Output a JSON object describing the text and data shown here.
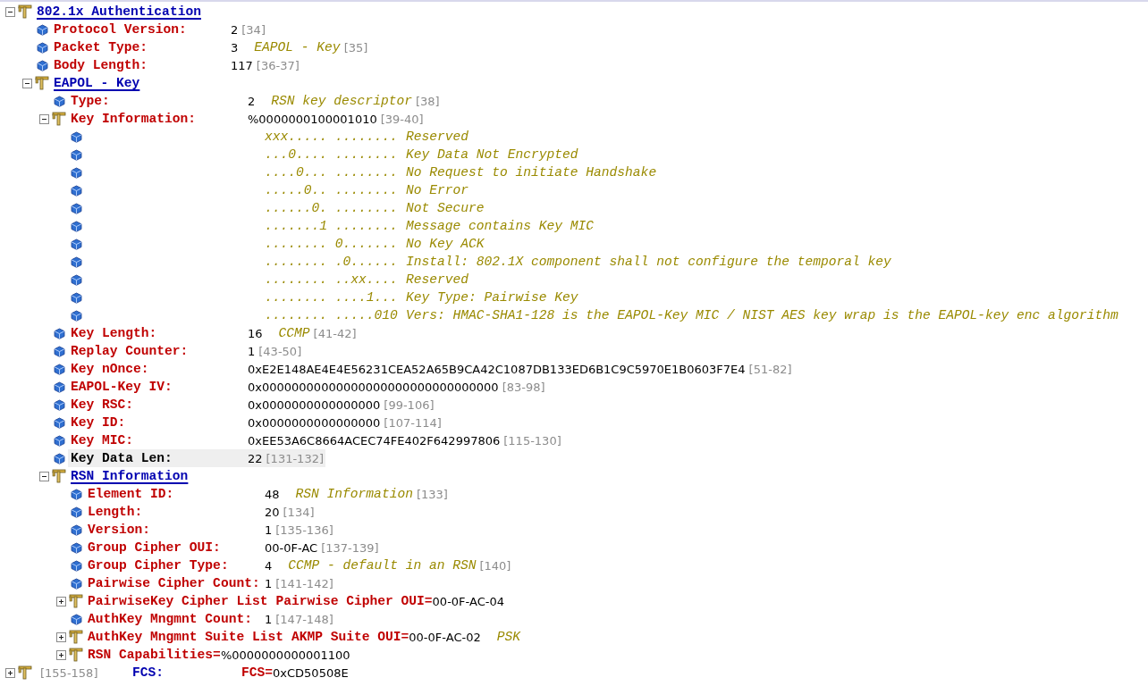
{
  "tree": [
    {
      "kind": "group",
      "label": "802.1x Authentication",
      "expanded": true,
      "selected": false,
      "children": [
        {
          "kind": "field",
          "label": "Protocol Version:",
          "value": "2",
          "range": "[34]",
          "selected": false
        },
        {
          "kind": "field",
          "label": "Packet Type:",
          "value": "3",
          "description": "EAPOL - Key",
          "range": "[35]",
          "selected": false
        },
        {
          "kind": "field",
          "label": "Body Length:",
          "value": "117",
          "range": "[36-37]",
          "selected": false
        },
        {
          "kind": "group",
          "label": "EAPOL - Key",
          "expanded": true,
          "selected": false,
          "children": [
            {
              "kind": "field",
              "label": "Type:",
              "value": "2",
              "description": "RSN key descriptor",
              "range": "[38]",
              "selected": false
            },
            {
              "kind": "group",
              "label": "Key Information:",
              "value": "%0000000100001010",
              "range": "[39-40]",
              "expanded": true,
              "selected": false,
              "children": [
                {
                  "kind": "bits",
                  "bits": "xxx..... ........",
                  "description": "Reserved",
                  "selected": false
                },
                {
                  "kind": "bits",
                  "bits": "...0.... ........",
                  "description": "Key Data Not Encrypted",
                  "selected": false
                },
                {
                  "kind": "bits",
                  "bits": "....0... ........",
                  "description": "No Request to initiate Handshake",
                  "selected": false
                },
                {
                  "kind": "bits",
                  "bits": ".....0.. ........",
                  "description": "No Error",
                  "selected": false
                },
                {
                  "kind": "bits",
                  "bits": "......0. ........",
                  "description": "Not Secure",
                  "selected": false
                },
                {
                  "kind": "bits",
                  "bits": ".......1 ........",
                  "description": "Message contains Key MIC",
                  "selected": false
                },
                {
                  "kind": "bits",
                  "bits": "........ 0.......",
                  "description": "No Key ACK",
                  "selected": false
                },
                {
                  "kind": "bits",
                  "bits": "........ .0......",
                  "description": "Install: 802.1X component shall not configure the temporal key",
                  "selected": false
                },
                {
                  "kind": "bits",
                  "bits": "........ ..xx....",
                  "description": "Reserved",
                  "selected": false
                },
                {
                  "kind": "bits",
                  "bits": "........ ....1...",
                  "description": "Key Type: Pairwise Key",
                  "selected": false
                },
                {
                  "kind": "bits",
                  "bits": "........ .....010",
                  "description": "Vers: HMAC-SHA1-128 is the EAPOL-Key MIC / NIST AES key wrap is the EAPOL-key enc algorithm",
                  "selected": false
                }
              ]
            },
            {
              "kind": "field",
              "label": "Key Length:",
              "value": "16",
              "description": "CCMP",
              "range": "[41-42]",
              "selected": false
            },
            {
              "kind": "field",
              "label": "Replay Counter:",
              "value": "1",
              "range": "[43-50]",
              "selected": false
            },
            {
              "kind": "field",
              "label": "Key nOnce:",
              "value": "0xE2E148AE4E4E56231CEA52A65B9CA42C1087DB133ED6B1C9C5970E1B0603F7E4",
              "range": "[51-82]",
              "selected": false
            },
            {
              "kind": "field",
              "label": "EAPOL-Key IV:",
              "value": "0x00000000000000000000000000000000",
              "range": "[83-98]",
              "selected": false
            },
            {
              "kind": "field",
              "label": "Key RSC:",
              "value": "0x0000000000000000",
              "range": "[99-106]",
              "selected": false
            },
            {
              "kind": "field",
              "label": "Key ID:",
              "value": "0x0000000000000000",
              "range": "[107-114]",
              "selected": false
            },
            {
              "kind": "field",
              "label": "Key MIC:",
              "value": "0xEE53A6C8664ACEC74FE402F642997806",
              "range": "[115-130]",
              "selected": false
            },
            {
              "kind": "field",
              "label": "Key Data Len:",
              "value": "22",
              "range": "[131-132]",
              "selected": true
            },
            {
              "kind": "group",
              "label": "RSN Information",
              "expanded": true,
              "selected": false,
              "children": [
                {
                  "kind": "field",
                  "label": "Element ID:",
                  "value": "48",
                  "description": "RSN Information",
                  "range": "[133]",
                  "selected": false
                },
                {
                  "kind": "field",
                  "label": "Length:",
                  "value": "20",
                  "range": "[134]",
                  "selected": false
                },
                {
                  "kind": "field",
                  "label": "Version:",
                  "value": "1",
                  "range": "[135-136]",
                  "selected": false
                },
                {
                  "kind": "field",
                  "label": "Group Cipher OUI:",
                  "value": "00-0F-AC",
                  "range": "[137-139]",
                  "selected": false
                },
                {
                  "kind": "field",
                  "label": "Group Cipher Type:",
                  "value": "4",
                  "description": "CCMP - default in an RSN",
                  "range": "[140]",
                  "selected": false
                },
                {
                  "kind": "field",
                  "label": "Pairwise Cipher Count:",
                  "value": "1",
                  "range": "[141-142]",
                  "selected": false
                },
                {
                  "kind": "summary",
                  "label": "PairwiseKey Cipher List",
                  "summary_label": "Pairwise Cipher OUI=",
                  "value": "00-0F-AC-04",
                  "expanded": false,
                  "selected": false
                },
                {
                  "kind": "field",
                  "label": "AuthKey Mngmnt Count:",
                  "value": "1",
                  "range": "[147-148]",
                  "selected": false
                },
                {
                  "kind": "summary",
                  "label": "AuthKey Mngmnt Suite List",
                  "summary_label": "AKMP Suite OUI=",
                  "value": "00-0F-AC-02",
                  "description": "PSK",
                  "expanded": false,
                  "selected": false
                },
                {
                  "kind": "summary",
                  "label": "RSN Capabilities=",
                  "value": "%0000000000001100",
                  "expanded": false,
                  "selected": false
                }
              ]
            }
          ]
        }
      ]
    },
    {
      "kind": "checksum",
      "range": "[155-158]",
      "label": "FCS:",
      "summary_label": "FCS=",
      "value": "0xCD50508E",
      "expanded": false,
      "selected": false
    }
  ]
}
